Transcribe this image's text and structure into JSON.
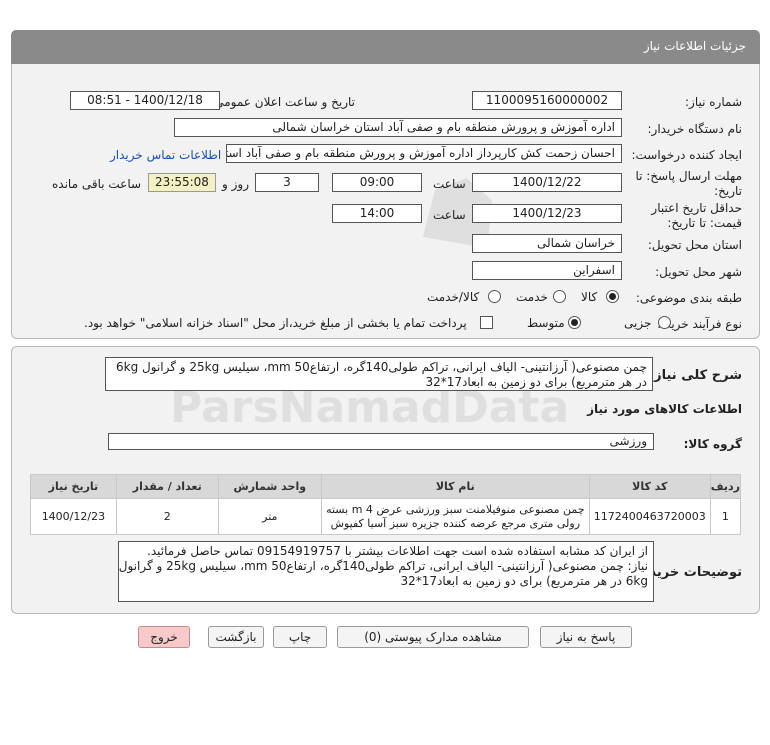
{
  "header": {
    "title": "جزئیات اطلاعات نیاز"
  },
  "form": {
    "need_number_label": "شماره نیاز:",
    "need_number": "1100095160000002",
    "announce_label": "تاریخ و ساعت اعلان عمومی:",
    "announce_value": "1400/12/18 - 08:51",
    "buyer_org_label": "نام دستگاه خریدار:",
    "buyer_org": "اداره آموزش و پرورش منطقه بام و صفی آباد استان خراسان شمالی",
    "requester_label": "ایجاد کننده درخواست:",
    "requester": "احسان زحمت کش کارپرداز اداره آموزش و پرورش منطقه بام و صفی آباد استان",
    "contact_link": "اطلاعات تماس خریدار",
    "deadline_label_1": "مهلت ارسال پاسخ: تا",
    "deadline_label_2": "تاریخ:",
    "deadline_date": "1400/12/22",
    "time_label": "ساعت",
    "deadline_time": "09:00",
    "days_value": "3",
    "days_label": "روز و",
    "remaining_time": "23:55:08",
    "remaining_label": "ساعت باقی مانده",
    "validity_label_1": "حداقل تاریخ اعتبار",
    "validity_label_2": "قیمت: تا تاریخ:",
    "validity_date": "1400/12/23",
    "validity_time_label": "ساعت",
    "validity_time": "14:00",
    "province_label": "استان محل تحویل:",
    "province": "خراسان شمالی",
    "city_label": "شهر محل تحویل:",
    "city": "اسفراین",
    "category_label": "طبقه بندی موضوعی:",
    "category_options": [
      "کالا",
      "خدمت",
      "کالا/خدمت"
    ],
    "purchase_type_label": "نوع فرآیند خرید :",
    "purchase_options": [
      "جزیی",
      "متوسط"
    ],
    "payment_note": "پرداخت تمام یا بخشی از مبلغ خرید،از محل \"اسناد خزانه اسلامی\" خواهد بود."
  },
  "details": {
    "summary_label": "شرح کلی نیاز:",
    "summary": "چمن مصنوعی( آرزانتینی- الیاف ایرانی، تراکم طولی140گره، ارتفاعmm 50، سیلیس 25kg و گرانول 6kg در هر مترمربع) برای دو زمین به ابعاد17*32",
    "goods_info_title": "اطلاعات کالاهای مورد نیاز",
    "group_label": "گروه کالا:",
    "group_value": "ورزشی",
    "table": {
      "headers": [
        "ردیف",
        "کد کالا",
        "نام کالا",
        "واحد شمارش",
        "تعداد / مقدار",
        "تاریخ نیاز"
      ],
      "rows": [
        {
          "row": "1",
          "code": "1172400463720003",
          "name": "چمن مصنوعی منوفیلامنت سبز ورزشی عرض m 4 بسته رولی متری مرجع عرضه کننده جزیره سبز آسیا کفپوش",
          "unit": "متر",
          "qty": "2",
          "date": "1400/12/23"
        }
      ]
    },
    "buyer_notes_label": "توضیحات خریدار:",
    "buyer_notes_line1": "از ایران کد مشابه استفاده شده است جهت اطلاعات بیشتر با 09154919757 تماس حاصل فرمائید.",
    "buyer_notes_line2": "نیاز: چمن مصنوعی( آرزانتینی- الیاف ایرانی، تراکم طولی140گره، ارتفاعmm 50، سیلیس 25kg و گرانول",
    "buyer_notes_line3": "6kg در هر مترمربع) برای دو زمین به ابعاد17*32"
  },
  "buttons": {
    "reply": "پاسخ به نیاز",
    "attachments": "مشاهده مدارک پیوستی (0)",
    "print": "چاپ",
    "back": "بازگشت",
    "exit": "خروج"
  }
}
